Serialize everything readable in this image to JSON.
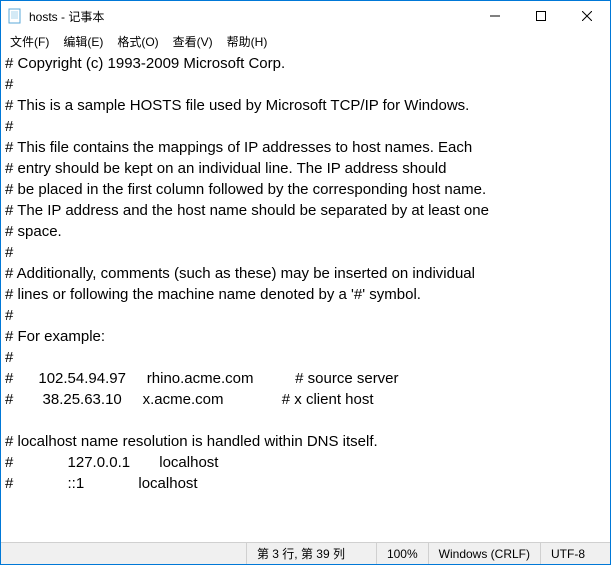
{
  "titlebar": {
    "title": "hosts - 记事本"
  },
  "menu": {
    "file": "文件(F)",
    "edit": "编辑(E)",
    "format": "格式(O)",
    "view": "查看(V)",
    "help": "帮助(H)"
  },
  "content": "# Copyright (c) 1993-2009 Microsoft Corp.\n#\n# This is a sample HOSTS file used by Microsoft TCP/IP for Windows.\n#\n# This file contains the mappings of IP addresses to host names. Each\n# entry should be kept on an individual line. The IP address should\n# be placed in the first column followed by the corresponding host name.\n# The IP address and the host name should be separated by at least one\n# space.\n#\n# Additionally, comments (such as these) may be inserted on individual\n# lines or following the machine name denoted by a '#' symbol.\n#\n# For example:\n#\n#      102.54.94.97     rhino.acme.com          # source server\n#       38.25.63.10     x.acme.com              # x client host\n\n# localhost name resolution is handled within DNS itself.\n#             127.0.0.1       localhost\n#             ::1             localhost",
  "statusbar": {
    "position": "第 3 行, 第 39 列",
    "zoom": "100%",
    "lineending": "Windows (CRLF)",
    "encoding": "UTF-8"
  }
}
